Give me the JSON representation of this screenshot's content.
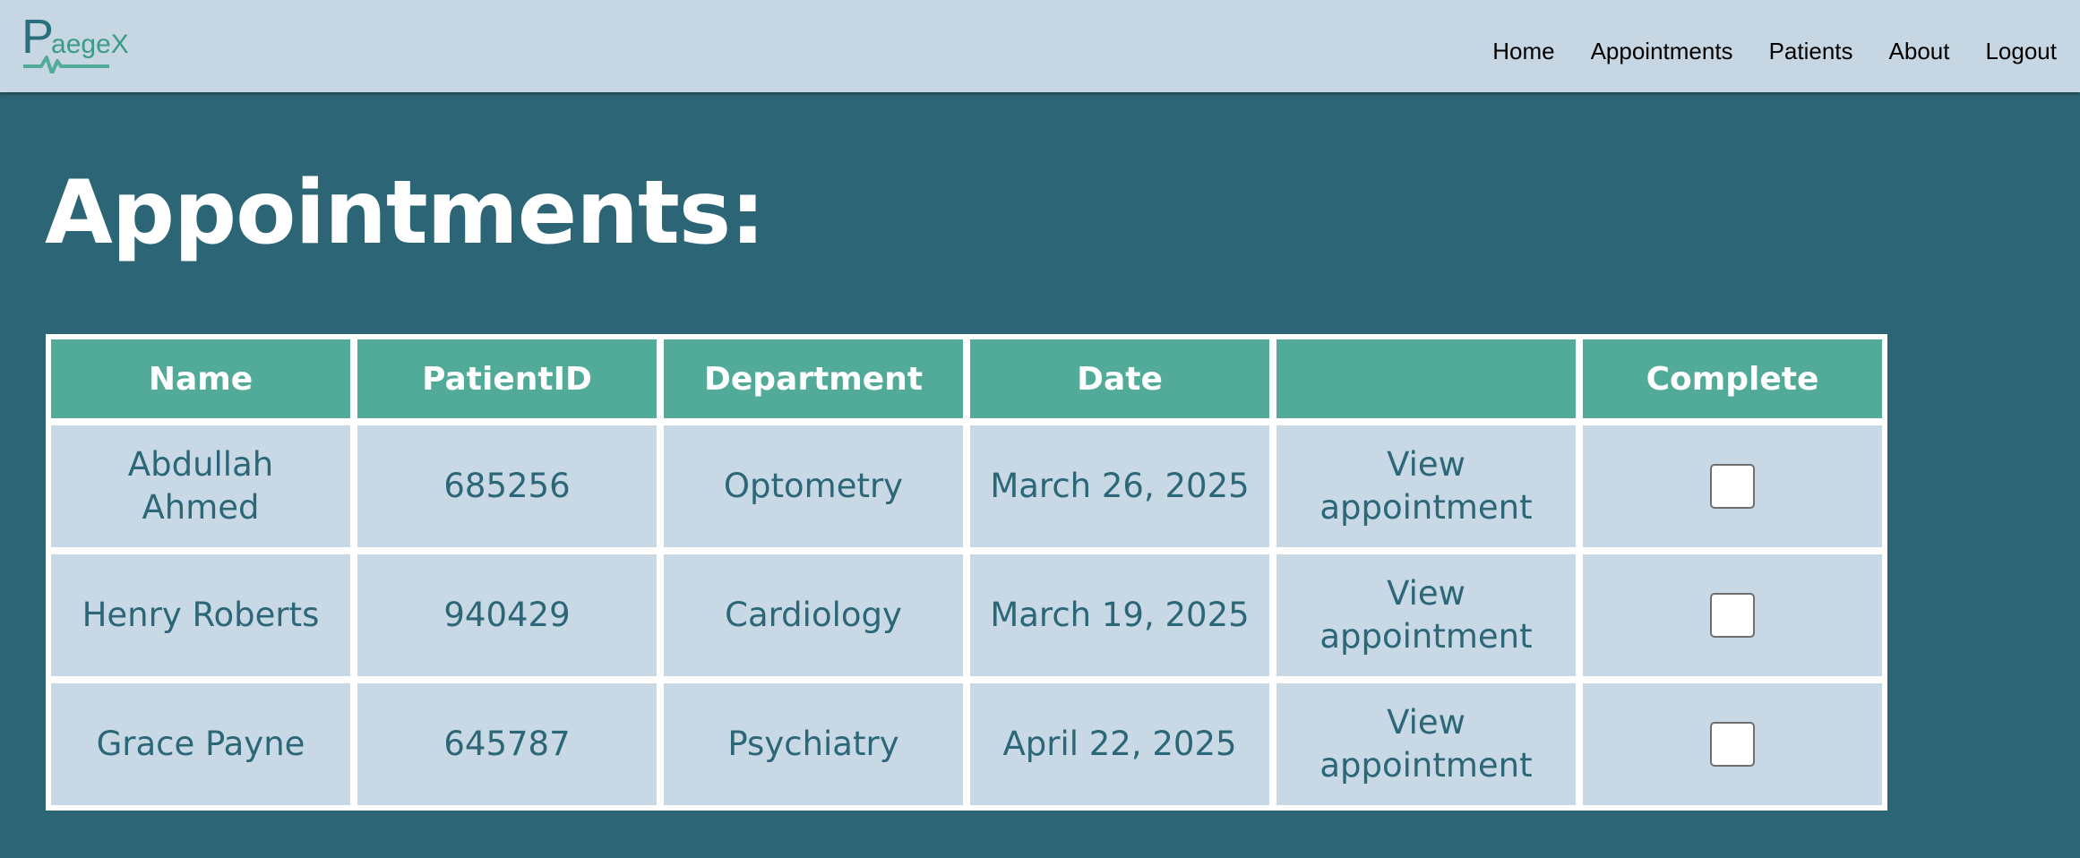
{
  "header": {
    "logo": {
      "letter": "P",
      "rest": "aegeX"
    },
    "nav": [
      "Home",
      "Appointments",
      "Patients",
      "About",
      "Logout"
    ]
  },
  "main": {
    "title": "Appointments:"
  },
  "table": {
    "columns": [
      "Name",
      "PatientID",
      "Department",
      "Date",
      "",
      "Complete"
    ],
    "rows": [
      {
        "name": "Abdullah Ahmed",
        "patient_id": "685256",
        "department": "Optometry",
        "date": "March 26, 2025",
        "action": "View appointment",
        "complete": false
      },
      {
        "name": "Henry Roberts",
        "patient_id": "940429",
        "department": "Cardiology",
        "date": "March 19, 2025",
        "action": "View appointment",
        "complete": false
      },
      {
        "name": "Grace Payne",
        "patient_id": "645787",
        "department": "Psychiatry",
        "date": "April 22, 2025",
        "action": "View appointment",
        "complete": false
      }
    ]
  },
  "colors": {
    "background": "#2c6676",
    "header": "#c6d7e3",
    "table_header": "#52ab98",
    "cell": "#c8d8e4",
    "cell_text": "#2b6777"
  }
}
